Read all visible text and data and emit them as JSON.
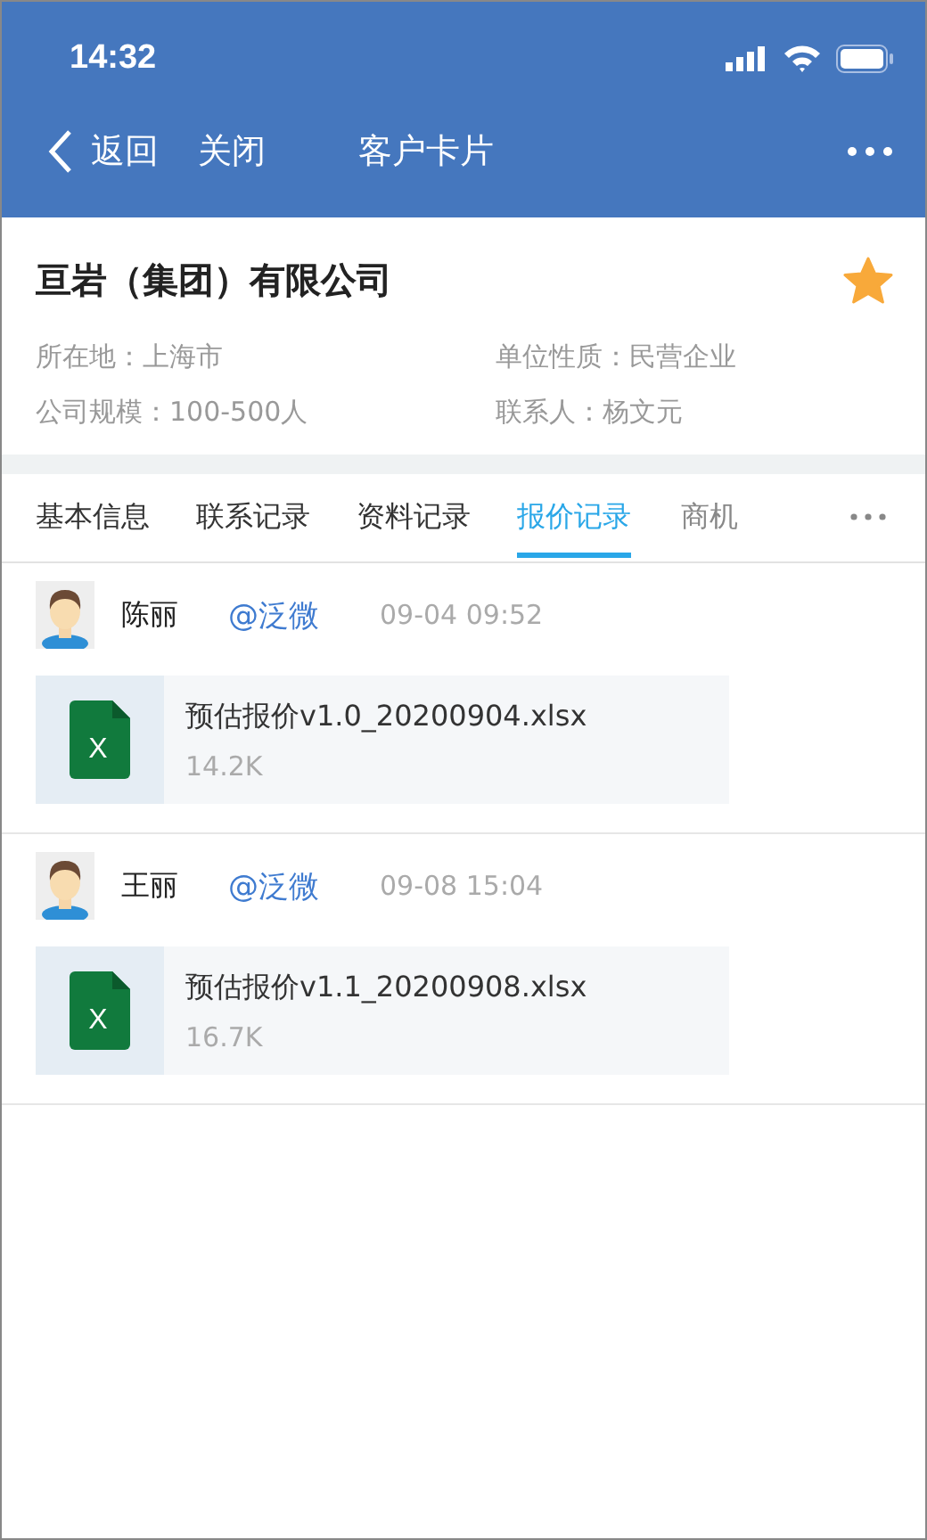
{
  "status_bar": {
    "time": "14:32"
  },
  "nav": {
    "back": "返回",
    "close": "关闭",
    "title": "客户卡片"
  },
  "company": {
    "name": "亘岩（集团）有限公司",
    "favorite": true,
    "fields": [
      {
        "label": "所在地：",
        "value": "上海市"
      },
      {
        "label": "单位性质：",
        "value": "民营企业"
      },
      {
        "label": "公司规模：",
        "value": "100-500人"
      },
      {
        "label": "联系人：",
        "value": "杨文元"
      }
    ]
  },
  "tabs": [
    {
      "label": "基本信息",
      "selected": false
    },
    {
      "label": "联系记录",
      "selected": false
    },
    {
      "label": "资料记录",
      "selected": false
    },
    {
      "label": "报价记录",
      "selected": true
    },
    {
      "label": "商机",
      "selected": false
    }
  ],
  "records": [
    {
      "author": "陈丽",
      "mention": "@泛微",
      "time": "09-04 09:52",
      "file": {
        "icon_letter": "X",
        "name": "预估报价v1.0_20200904.xlsx",
        "size": "14.2K"
      }
    },
    {
      "author": "王丽",
      "mention": "@泛微",
      "time": "09-08 15:04",
      "file": {
        "icon_letter": "X",
        "name": "预估报价v1.1_20200908.xlsx",
        "size": "16.7K"
      }
    }
  ]
}
